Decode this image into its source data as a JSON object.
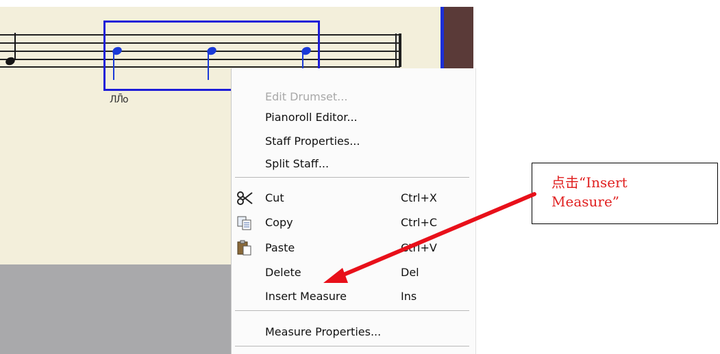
{
  "staff": {
    "tab_marks": "ЛЛ̄о"
  },
  "context_menu": {
    "items_top": [
      {
        "name": "menu-edit-drumset",
        "label": "Edit Drumset...",
        "disabled": true
      },
      {
        "name": "menu-pianoroll-editor",
        "label": "Pianoroll Editor..."
      },
      {
        "name": "menu-staff-properties",
        "label": "Staff Properties..."
      },
      {
        "name": "menu-split-staff",
        "label": "Split Staff..."
      }
    ],
    "cut": {
      "label": "Cut",
      "shortcut": "Ctrl+X",
      "icon": "scissors-icon"
    },
    "copy": {
      "label": "Copy",
      "shortcut": "Ctrl+C",
      "icon": "copy-icon"
    },
    "paste": {
      "label": "Paste",
      "shortcut": "Ctrl+V",
      "icon": "paste-icon"
    },
    "delete": {
      "label": "Delete",
      "shortcut": "Del"
    },
    "insert_measure": {
      "label": "Insert Measure",
      "shortcut": "Ins"
    },
    "measure_properties": {
      "label": "Measure Properties..."
    }
  },
  "annotation": {
    "callout_line1": "点击“Insert",
    "callout_line2": "Measure”",
    "color": "#e02020"
  },
  "colors": {
    "selection": "#1c1cd8",
    "score_background": "#f3efdb",
    "note_blue": "#1a3ad8"
  }
}
